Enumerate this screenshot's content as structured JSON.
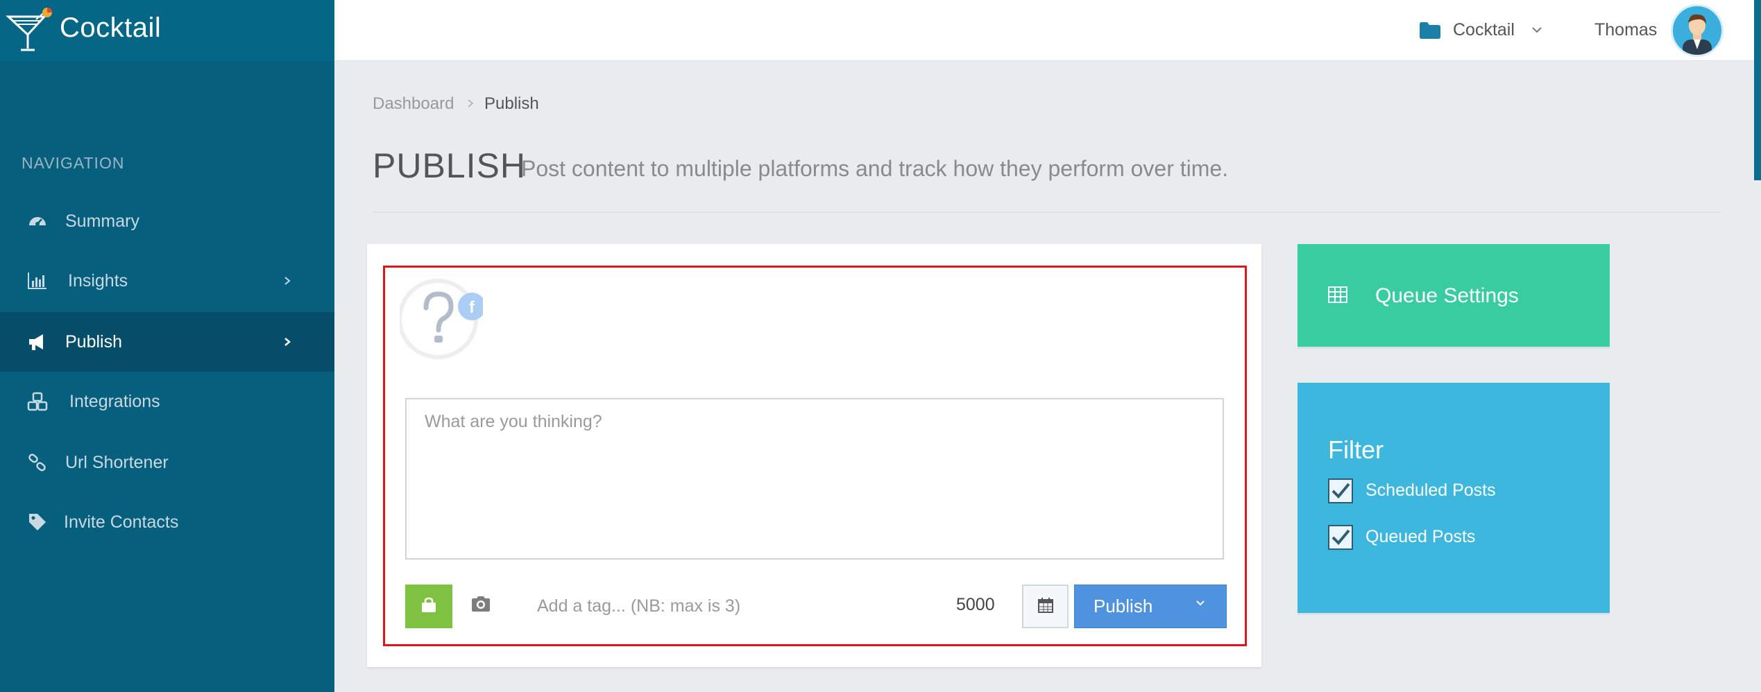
{
  "app": {
    "brand_name": "Cocktail"
  },
  "sidebar": {
    "heading": "NAVIGATION",
    "items": [
      {
        "label": "Summary",
        "icon": "dashboard-icon",
        "has_chevron": false,
        "active": false
      },
      {
        "label": "Insights",
        "icon": "bar-chart-icon",
        "has_chevron": true,
        "active": false
      },
      {
        "label": "Publish",
        "icon": "megaphone-icon",
        "has_chevron": true,
        "active": true
      },
      {
        "label": "Integrations",
        "icon": "cubes-icon",
        "has_chevron": false,
        "active": false
      },
      {
        "label": "Url Shortener",
        "icon": "link-icon",
        "has_chevron": false,
        "active": false
      },
      {
        "label": "Invite Contacts",
        "icon": "tag-icon",
        "has_chevron": false,
        "active": false
      }
    ]
  },
  "topbar": {
    "workspace_label": "Cocktail",
    "user_name": "Thomas"
  },
  "breadcrumb": {
    "root": "Dashboard",
    "current": "Publish"
  },
  "page": {
    "title": "PUBLISH",
    "subtitle": "Post content to multiple platforms and track how they perform over time."
  },
  "composer": {
    "text_placeholder": "What are you thinking?",
    "tag_placeholder": "Add a tag... (NB: max is 3)",
    "char_count": "5000",
    "publish_label": "Publish"
  },
  "queue_settings": {
    "label": "Queue Settings"
  },
  "filter": {
    "title": "Filter",
    "options": [
      {
        "label": "Scheduled Posts",
        "checked": true
      },
      {
        "label": "Queued Posts",
        "checked": true
      }
    ]
  },
  "colors": {
    "sidebar_bg": "#075f7e",
    "sidebar_active": "#054d68",
    "queue_green": "#39cca0",
    "filter_blue": "#3db7dd",
    "publish_blue": "#4f93de",
    "media_green": "#7fc241",
    "highlight_red": "#e0161c"
  }
}
